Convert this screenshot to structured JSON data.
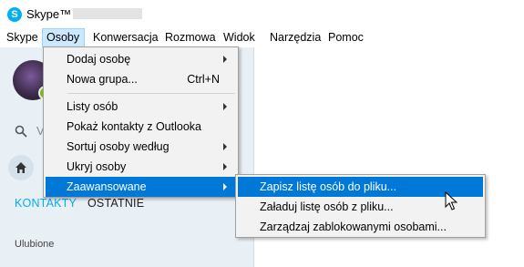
{
  "window": {
    "title": "Skype™ -",
    "icon": "skype-logo-icon"
  },
  "menubar": {
    "items": [
      "Skype",
      "Osoby",
      "Konwersacja",
      "Rozmowa",
      "Widok",
      "Narzędzia",
      "Pomoc"
    ],
    "active": "Osoby"
  },
  "sidebar": {
    "search_fragment": "V",
    "tabs": [
      "KONTAKTY",
      "OSTATNIE"
    ],
    "active_tab": "KONTAKTY",
    "section_label": "Ulubione"
  },
  "osoby_menu": {
    "items": [
      {
        "label": "Dodaj osobę",
        "shortcut": "",
        "submenu": true
      },
      {
        "label": "Nowa grupa...",
        "shortcut": "Ctrl+N",
        "submenu": false
      },
      {
        "label": "Listy osób",
        "shortcut": "",
        "submenu": true
      },
      {
        "label": "Pokaż kontakty z Outlooka",
        "shortcut": "",
        "submenu": false
      },
      {
        "label": "Sortuj osoby według",
        "shortcut": "",
        "submenu": true
      },
      {
        "label": "Ukryj osoby",
        "shortcut": "",
        "submenu": true
      },
      {
        "label": "Zaawansowane",
        "shortcut": "",
        "submenu": true,
        "highlighted": true
      }
    ]
  },
  "zaawansowane_submenu": {
    "items": [
      {
        "label": "Zapisz listę osób do pliku...",
        "highlighted": true
      },
      {
        "label": "Załaduj listę osób z pliku...",
        "highlighted": false
      },
      {
        "label": "Zarządzaj zablokowanymi osobami...",
        "highlighted": false
      }
    ]
  },
  "colors": {
    "accent": "#00aff0",
    "menu_highlight": "#0078d7",
    "menubar_active": "#cce8ff",
    "sidebar_bg": "#e8eff5",
    "menu_bg": "#f2f2f2"
  }
}
